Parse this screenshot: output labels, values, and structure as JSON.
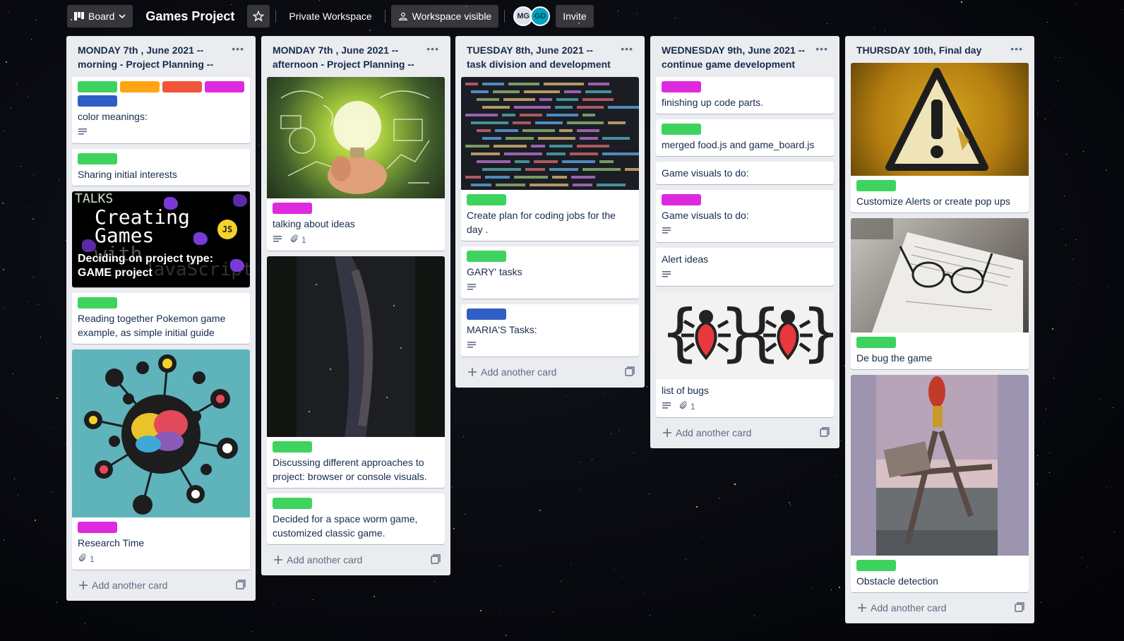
{
  "header": {
    "view_label": "Board",
    "title": "Games Project",
    "workspace_label": "Private Workspace",
    "visibility_label": "Workspace visible",
    "members": [
      "MG",
      "GD"
    ],
    "invite_label": "Invite"
  },
  "colors": {
    "green": "#3ed35f",
    "orange": "#ffa513",
    "red": "#f0553b",
    "purple": "#dd2ade",
    "blue": "#2f5fc4"
  },
  "add_card_label": "Add another card",
  "lists": [
    {
      "title": "MONDAY 7th , June 2021 -- morning - Project Planning --",
      "cards": [
        {
          "title": "color meanings:",
          "labels": [
            "green",
            "orange",
            "red",
            "purple",
            "blue"
          ],
          "description": true
        },
        {
          "title": "Sharing initial interests",
          "labels": [
            "green"
          ]
        },
        {
          "title": "Deciding on project type: GAME project",
          "cover": "talks",
          "cover_text": [
            "TALKS",
            "Creating",
            "Games",
            "with",
            "JavaScript",
            "JS"
          ]
        },
        {
          "title": "Reading together Pokemon game example, as simple initial guide",
          "labels": [
            "green"
          ]
        },
        {
          "title": "Research Time",
          "labels": [
            "purple"
          ],
          "cover": "brain",
          "attachments": "1"
        }
      ]
    },
    {
      "title": "MONDAY 7th , June 2021 -- afternoon - Project Planning --",
      "cards": [
        {
          "title": "talking about ideas",
          "labels": [
            "purple"
          ],
          "cover": "bulb",
          "description": true,
          "attachments": "1"
        },
        {
          "title": "Discussing different approaches to project: browser or console visuals.",
          "labels": [
            "green"
          ],
          "cover": "milky"
        },
        {
          "title": "Decided for a space worm game, customized classic game.",
          "labels": [
            "green"
          ]
        }
      ]
    },
    {
      "title": "TUESDAY 8th, June 2021 -- task division and development",
      "cards": [
        {
          "title": "Create plan for coding jobs for the day .",
          "labels": [
            "green"
          ],
          "cover": "code"
        },
        {
          "title": "GARY' tasks",
          "labels": [
            "green"
          ],
          "description": true
        },
        {
          "title": "MARIA'S Tasks:",
          "labels": [
            "blue"
          ],
          "description": true
        }
      ]
    },
    {
      "title": "WEDNESDAY 9th, June 2021 -- continue game development",
      "cards": [
        {
          "title": "finishing up code parts.",
          "labels": [
            "purple"
          ]
        },
        {
          "title": "merged food.js and game_board.js",
          "labels": [
            "green"
          ]
        },
        {
          "title": "Game visuals to do:"
        },
        {
          "title": "Game visuals to do:",
          "labels": [
            "purple"
          ],
          "description": true
        },
        {
          "title": "Alert ideas",
          "description": true
        },
        {
          "title": "list of bugs",
          "cover": "bugs",
          "description": true,
          "attachments": "1"
        }
      ]
    },
    {
      "title": "THURSDAY 10th, Final day",
      "cards": [
        {
          "title": "Customize Alerts or create pop ups",
          "labels": [
            "green"
          ],
          "cover": "warning"
        },
        {
          "title": "De bug the game",
          "labels": [
            "green"
          ],
          "cover": "glasses"
        },
        {
          "title": "Obstacle detection",
          "labels": [
            "green"
          ],
          "cover": "pier"
        }
      ]
    }
  ]
}
